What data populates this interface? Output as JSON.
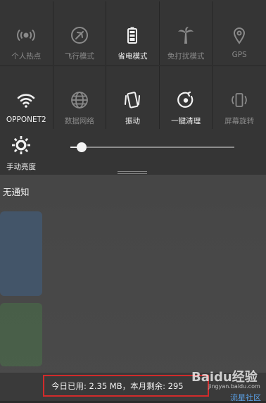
{
  "quick_settings": {
    "row1": [
      {
        "label": "个人热点",
        "icon": "hotspot-icon",
        "state": "off"
      },
      {
        "label": "飞行模式",
        "icon": "airplane-icon",
        "state": "off"
      },
      {
        "label": "省电模式",
        "icon": "battery-icon",
        "state": "on"
      },
      {
        "label": "免打扰模式",
        "icon": "palm-tree-icon",
        "state": "off"
      },
      {
        "label": "GPS",
        "icon": "location-pin-icon",
        "state": "off"
      }
    ],
    "row2": [
      {
        "label": "OPPONET2",
        "icon": "wifi-icon",
        "state": "on"
      },
      {
        "label": "数据网络",
        "icon": "globe-icon",
        "state": "off"
      },
      {
        "label": "振动",
        "icon": "vibrate-icon",
        "state": "on"
      },
      {
        "label": "一键清理",
        "icon": "clean-icon",
        "state": "on"
      },
      {
        "label": "屏幕旋转",
        "icon": "rotate-icon",
        "state": "off"
      }
    ]
  },
  "brightness": {
    "label": "手动亮度",
    "icon": "brightness-icon",
    "level": 0.05
  },
  "notifications": {
    "empty_label": "无通知"
  },
  "data_usage": {
    "text": "今日已用: 2.35 MB，本月剩余: 295"
  },
  "watermark": {
    "logo": "Baidu经验",
    "url": "jingyan.baidu.com",
    "site": "流星社区"
  },
  "colors": {
    "highlight_border": "#d12b2b",
    "active_icon": "#f2f2f2",
    "inactive_icon": "#8a8a8a"
  }
}
